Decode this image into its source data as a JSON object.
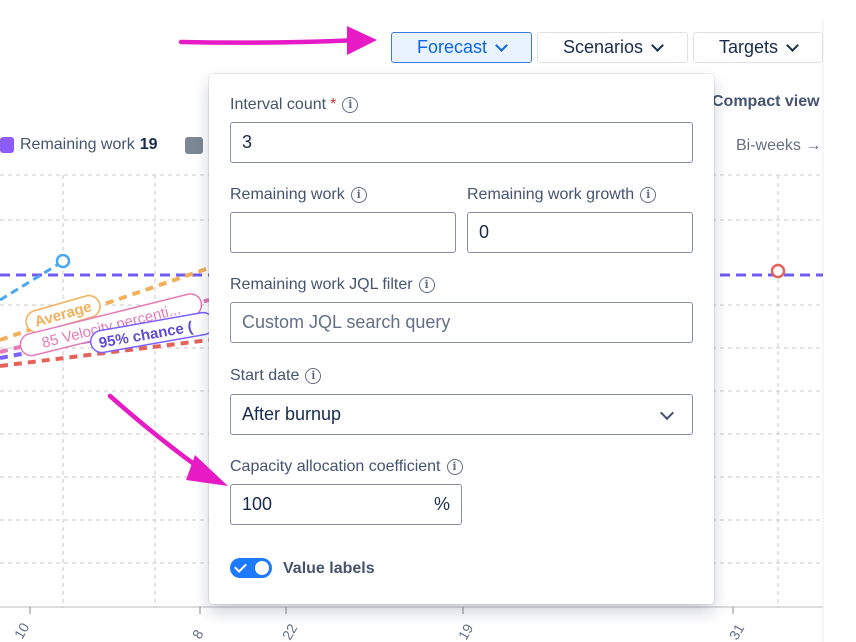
{
  "toolbar": {
    "forecast_label": "Forecast",
    "scenarios_label": "Scenarios",
    "targets_label": "Targets",
    "compact_view": "Compact view"
  },
  "legend": {
    "remaining_work_label": "Remaining work",
    "remaining_work_value": "19",
    "remaining_work_color": "#8b5cf6",
    "second_swatch_color": "#7b8794"
  },
  "chart": {
    "period_label": "Bi-weeks →",
    "x_ticks": [
      "10",
      "8",
      "22",
      "19",
      "31"
    ],
    "labels": {
      "average": "Average",
      "velocity": "85 Velocity percenti...",
      "chance": "95% chance ("
    }
  },
  "form": {
    "interval_count_label": "Interval count",
    "interval_count_required": "*",
    "interval_count_value": "3",
    "remaining_work_label": "Remaining work",
    "remaining_work_value": "",
    "remaining_work_growth_label": "Remaining work growth",
    "remaining_work_growth_value": "0",
    "jql_filter_label": "Remaining work JQL filter",
    "jql_filter_placeholder": "Custom JQL search query",
    "start_date_label": "Start date",
    "start_date_value": "After burnup",
    "capacity_label": "Capacity allocation coefficient",
    "capacity_value": "100",
    "capacity_unit": "%",
    "value_labels_label": "Value labels",
    "value_labels_on": true
  },
  "colors": {
    "accent": "#0c66e4",
    "annotation_arrow": "#e61bc6",
    "average_line": "#f2b05b",
    "velocity_line": "#e57cb8",
    "chance_line": "#7b61ff",
    "remaining_line": "#6f5cf0",
    "red_line": "#e5625b",
    "blue_line": "#4aa8f0"
  }
}
